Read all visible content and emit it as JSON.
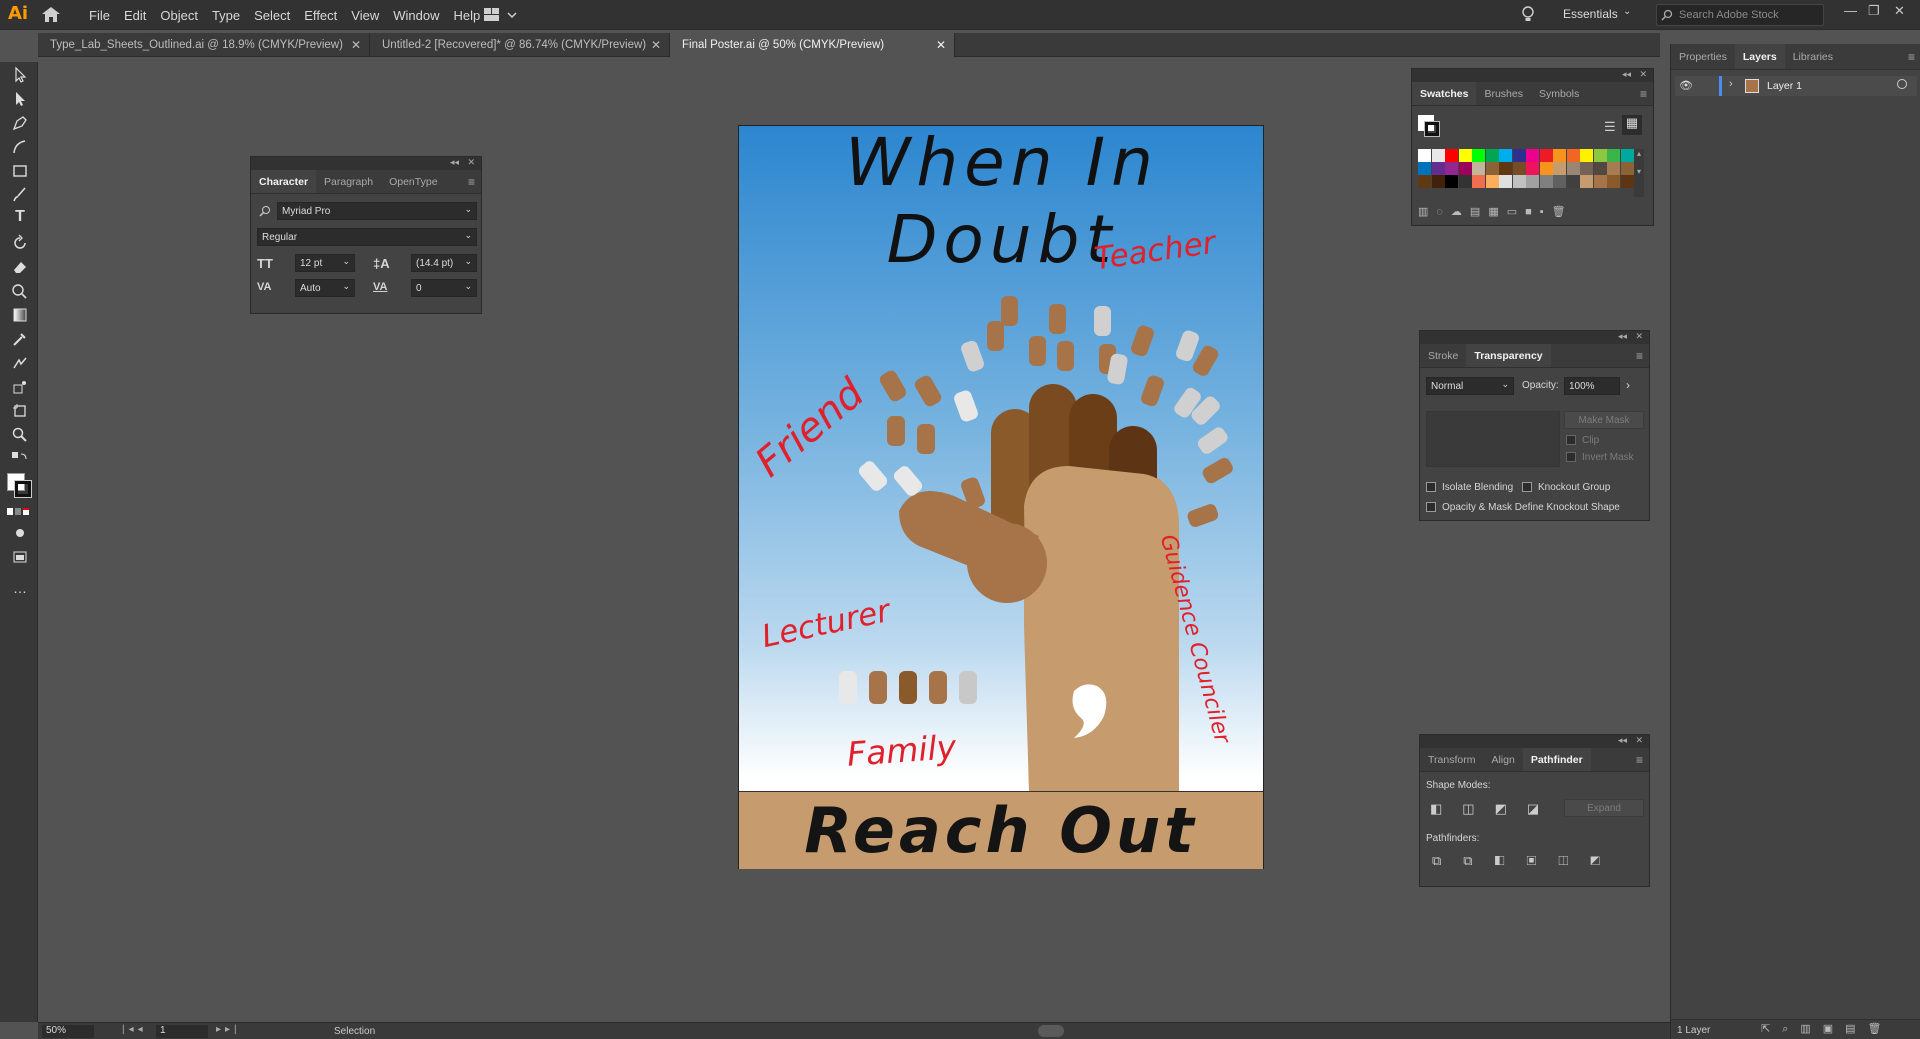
{
  "app": {
    "logo": "Ai"
  },
  "menu": [
    "File",
    "Edit",
    "Object",
    "Type",
    "Select",
    "Effect",
    "View",
    "Window",
    "Help"
  ],
  "topbar": {
    "workspace": "Essentials",
    "search_placeholder": "Search Adobe Stock"
  },
  "tabs": [
    {
      "label": "Type_Lab_Sheets_Outlined.ai @ 18.9% (CMYK/Preview)"
    },
    {
      "label": "Untitled-2 [Recovered]* @ 86.74% (CMYK/Preview)"
    },
    {
      "label": "Final Poster.ai @ 50% (CMYK/Preview)"
    }
  ],
  "character_panel": {
    "tabs": [
      "Character",
      "Paragraph",
      "OpenType"
    ],
    "font": "Myriad Pro",
    "style": "Regular",
    "size": "12 pt",
    "leading": "(14.4 pt)",
    "kerning": "Auto",
    "tracking": "0"
  },
  "poster": {
    "title": "When In Doubt",
    "bottom_text": "Reach Out",
    "words": {
      "teacher": "Teacher",
      "friend": "Friend",
      "lecturer": "Lecturer",
      "family": "Family",
      "guidance": "Guidence Counciler"
    },
    "colors": {
      "sky_top": "#2c86cf",
      "ground": "#c69b6d",
      "words": "#e0202a"
    }
  },
  "swatches_panel": {
    "tabs": [
      "Swatches",
      "Brushes",
      "Symbols"
    ]
  },
  "transparency_panel": {
    "tabs": [
      "Stroke",
      "Transparency"
    ],
    "blend_mode": "Normal",
    "opacity_label": "Opacity:",
    "opacity": "100%",
    "make_mask": "Make Mask",
    "clip": "Clip",
    "invert_mask": "Invert Mask",
    "isolate_blending": "Isolate Blending",
    "knockout_group": "Knockout Group",
    "opacity_mask": "Opacity & Mask Define Knockout Shape"
  },
  "pathfinder_panel": {
    "tabs": [
      "Transform",
      "Align",
      "Pathfinder"
    ],
    "shape_modes": "Shape Modes:",
    "expand": "Expand",
    "pathfinders": "Pathfinders:"
  },
  "right_panel": {
    "tabs": [
      "Properties",
      "Layers",
      "Libraries"
    ],
    "layer_name": "Layer 1",
    "footer": "1 Layer"
  },
  "status": {
    "zoom": "50%",
    "artboard": "1",
    "tool": "Selection"
  }
}
